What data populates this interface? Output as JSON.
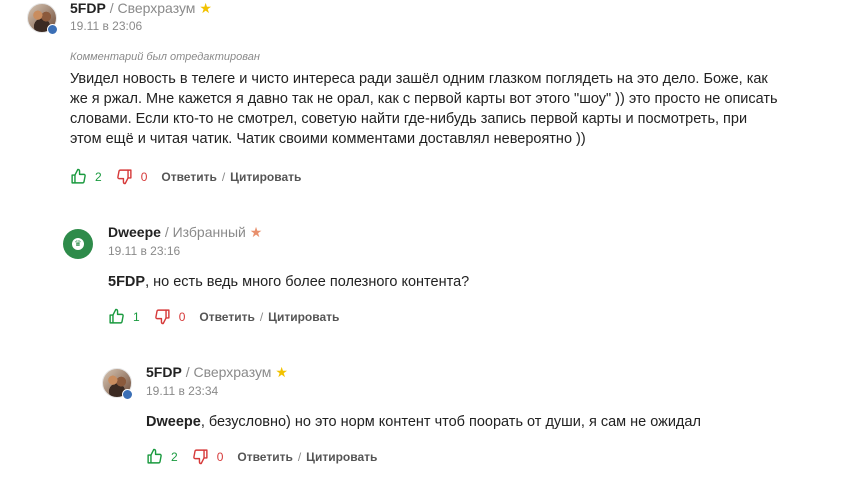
{
  "comments": [
    {
      "author": "5FDP",
      "rank": "/ Сверхразум",
      "star": "★",
      "time": "19.11 в 23:06",
      "edited_note": "Комментарий был отредактирован",
      "text": "Увидел новость в телеге и чисто интереса ради зашёл одним глазком поглядеть на это дело. Боже, как же я ржал. Мне кажется я давно так не орал, как с первой карты вот этого \"шоу\" )) это просто не описать словами. Если кто-то не смотрел, советую найти где-нибудь запись первой карты и посмотреть, при этом ещё и читая чатик. Чатик своими комментами доставлял невероятно ))",
      "likes": "2",
      "dislikes": "0",
      "reply_label": "Ответить",
      "separator": "/",
      "quote_label": "Цитировать"
    },
    {
      "author": "Dweepe",
      "rank": "/ Избранный",
      "star": "★",
      "time": "19.11 в 23:16",
      "mention": "5FDP",
      "text": ", но есть ведь много более полезного контента?",
      "likes": "1",
      "dislikes": "0",
      "reply_label": "Ответить",
      "separator": "/",
      "quote_label": "Цитировать"
    },
    {
      "author": "5FDP",
      "rank": "/ Сверхразум",
      "star": "★",
      "time": "19.11 в 23:34",
      "mention": "Dweepe",
      "text": ", безусловно) но это норм контент чтоб поорать от души, я сам не ожидал",
      "likes": "2",
      "dislikes": "0",
      "reply_label": "Ответить",
      "separator": "/",
      "quote_label": "Цитировать"
    }
  ],
  "colors": {
    "like_green": "#1a9a3f",
    "dislike_red": "#d63a3a",
    "muted_gray": "#8a8a8a",
    "star_gold": "#f2c200",
    "star_orange": "#e8906d",
    "avatar_green": "#2e8b4a"
  },
  "icons": {
    "like": "thumbs-up-icon",
    "dislike": "thumbs-down-icon",
    "rank_star": "star-icon"
  }
}
